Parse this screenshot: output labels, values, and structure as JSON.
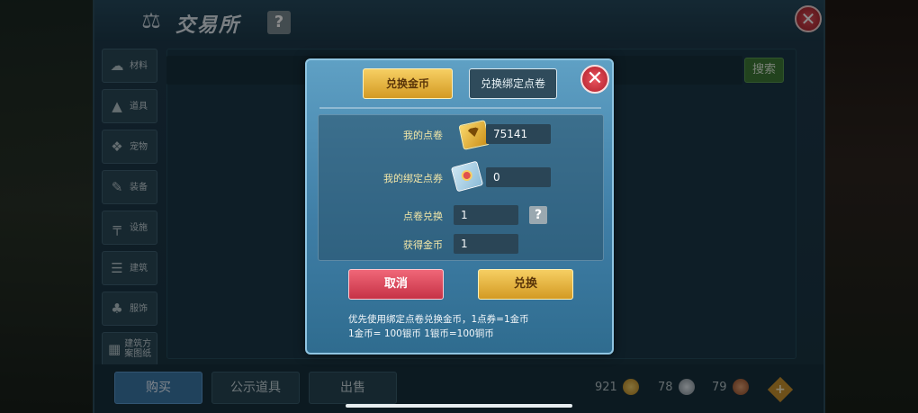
{
  "window": {
    "title": "交易所",
    "help": "?",
    "close": "✕"
  },
  "sidebar": {
    "items": [
      {
        "label": "材料",
        "icon": "material-icon"
      },
      {
        "label": "道具",
        "icon": "item-icon"
      },
      {
        "label": "宠物",
        "icon": "pet-icon"
      },
      {
        "label": "装备",
        "icon": "equipment-icon"
      },
      {
        "label": "设施",
        "icon": "facility-icon"
      },
      {
        "label": "建筑",
        "icon": "building-icon"
      },
      {
        "label": "服饰",
        "icon": "clothing-icon"
      },
      {
        "label": "建筑方案图纸",
        "icon": "blueprint-icon"
      }
    ]
  },
  "search": {
    "button": "搜索"
  },
  "bottom": {
    "tabs": [
      "购买",
      "公示道具",
      "出售"
    ],
    "gold": "921",
    "silver": "78",
    "copper": "79",
    "add": "+"
  },
  "dialog": {
    "tab_gold": "兑换金币",
    "tab_bound": "兑换绑定点卷",
    "close": "✕",
    "my_points_label": "我的点卷",
    "my_points_value": "75141",
    "my_bound_label": "我的绑定点券",
    "my_bound_value": "0",
    "exchange_label": "点卷兑换",
    "exchange_value": "1",
    "help": "?",
    "receive_label": "获得金币",
    "receive_value": "1",
    "cancel": "取消",
    "confirm": "兑换",
    "note_line1": "优先使用绑定点卷兑换金币，1点券=1金币",
    "note_line2": "1金币= 100银币  1银币=100铜币"
  },
  "colors": {
    "gold_button": "#e3b33f",
    "cancel_button": "#d9475a",
    "dialog_bg": "#4a8ab0"
  }
}
